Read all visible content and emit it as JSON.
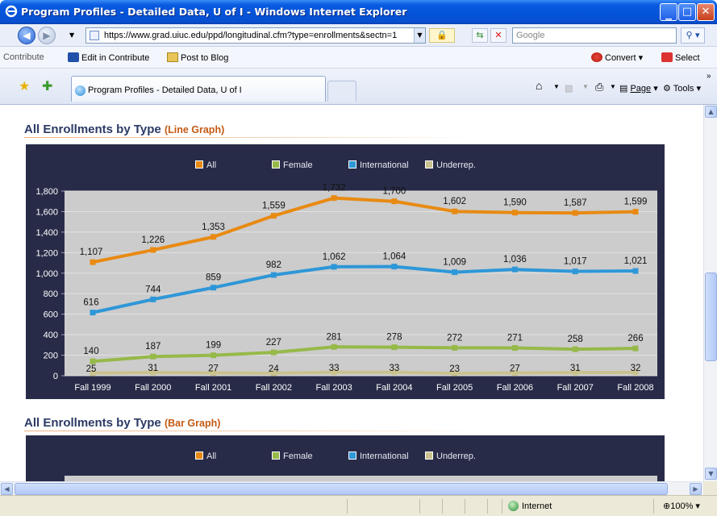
{
  "window": {
    "title": "Program Profiles - Detailed Data, U of I - Windows Internet Explorer"
  },
  "address": {
    "url": "https://www.grad.uiuc.edu/ppd/longitudinal.cfm?type=enrollments&sectn=1",
    "search_placeholder": "Google"
  },
  "contribute_bar": {
    "label": "Contribute",
    "edit": "Edit in Contribute",
    "post": "Post to Blog",
    "convert": "Convert",
    "select": "Select"
  },
  "tabs": {
    "active_title": "Program Profiles - Detailed Data, U of I"
  },
  "command_bar": {
    "page": "Page",
    "tools": "Tools"
  },
  "sections": {
    "line_title": "All Enrollments by Type",
    "line_sub": "(Line Graph)",
    "bar_title": "All Enrollments by Type",
    "bar_sub": "(Bar Graph)"
  },
  "legend": [
    {
      "label": "All",
      "color": "#e88a12"
    },
    {
      "label": "Female",
      "color": "#96b949"
    },
    {
      "label": "International",
      "color": "#2e97d8"
    },
    {
      "label": "Underrep.",
      "color": "#c9c28f"
    }
  ],
  "chart_data": {
    "type": "line",
    "categories": [
      "Fall 1999",
      "Fall 2000",
      "Fall 2001",
      "Fall 2002",
      "Fall 2003",
      "Fall 2004",
      "Fall 2005",
      "Fall 2006",
      "Fall 2007",
      "Fall 2008"
    ],
    "ylim": [
      0,
      1800
    ],
    "yticks": [
      "0",
      "200",
      "400",
      "600",
      "800",
      "1,000",
      "1,200",
      "1,400",
      "1,600",
      "1,800"
    ],
    "series": [
      {
        "name": "All",
        "color": "#e88a12",
        "values": [
          1107,
          1226,
          1353,
          1559,
          1732,
          1700,
          1602,
          1590,
          1587,
          1599
        ],
        "labels": [
          "1,107",
          "1,226",
          "1,353",
          "1,559",
          "1,732",
          "1,700",
          "1,602",
          "1,590",
          "1,587",
          "1,599"
        ]
      },
      {
        "name": "Female",
        "color": "#96b949",
        "values": [
          140,
          187,
          199,
          227,
          281,
          278,
          272,
          271,
          258,
          266
        ],
        "labels": [
          "140",
          "187",
          "199",
          "227",
          "281",
          "278",
          "272",
          "271",
          "258",
          "266"
        ]
      },
      {
        "name": "International",
        "color": "#2e97d8",
        "values": [
          616,
          744,
          859,
          982,
          1062,
          1064,
          1009,
          1036,
          1017,
          1021
        ],
        "labels": [
          "616",
          "744",
          "859",
          "982",
          "1,062",
          "1,064",
          "1,009",
          "1,036",
          "1,017",
          "1,021"
        ]
      },
      {
        "name": "Underrep.",
        "color": "#c9c28f",
        "values": [
          25,
          31,
          27,
          24,
          33,
          33,
          23,
          27,
          31,
          32
        ],
        "labels": [
          "25",
          "31",
          "27",
          "24",
          "33",
          "33",
          "23",
          "27",
          "31",
          "32"
        ]
      }
    ]
  },
  "status": {
    "zone": "Internet",
    "zoom": "100%"
  }
}
